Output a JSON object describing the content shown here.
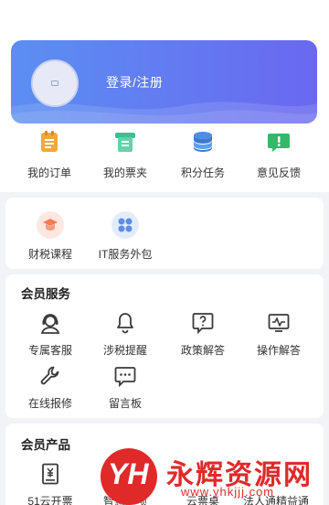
{
  "header": {
    "login_label": "登录/注册"
  },
  "quick_actions": [
    {
      "label": "我的订单",
      "icon": "orders-icon",
      "color": "#f2a93b"
    },
    {
      "label": "我的票夹",
      "icon": "ticket-folder-icon",
      "color": "#3cc08f"
    },
    {
      "label": "积分任务",
      "icon": "points-stack-icon",
      "color": "#4b8fe0"
    },
    {
      "label": "意见反馈",
      "icon": "feedback-icon",
      "color": "#34b86a"
    }
  ],
  "services": [
    {
      "label": "财税课程",
      "icon": "course-icon",
      "color": "#f47b57"
    },
    {
      "label": "IT服务外包",
      "icon": "it-outsourcing-icon",
      "color": "#5a8ee8"
    }
  ],
  "member_services": {
    "title": "会员服务",
    "items": [
      {
        "label": "专属客服",
        "icon": "customer-service-icon"
      },
      {
        "label": "涉税提醒",
        "icon": "bell-icon"
      },
      {
        "label": "政策解答",
        "icon": "question-icon"
      },
      {
        "label": "操作解答",
        "icon": "monitor-icon"
      },
      {
        "label": "在线报修",
        "icon": "wrench-icon"
      },
      {
        "label": "留言板",
        "icon": "message-board-icon"
      }
    ]
  },
  "member_products": {
    "title": "会员产品",
    "items": [
      {
        "label": "51云开票",
        "icon": "invoice-icon"
      },
      {
        "label": "智慧进项",
        "icon": ""
      },
      {
        "label": "云票桌",
        "icon": ""
      },
      {
        "label": "法人通精益通",
        "icon": ""
      }
    ]
  },
  "watermark": {
    "logo_text": "YH",
    "title": "永辉资源网",
    "url": "www.yhkjjj.com"
  },
  "colors": {
    "banner_start": "#5b8ff2",
    "banner_end": "#6a68f0",
    "icon_dark": "#3a3a3a",
    "watermark": "#e02929"
  }
}
